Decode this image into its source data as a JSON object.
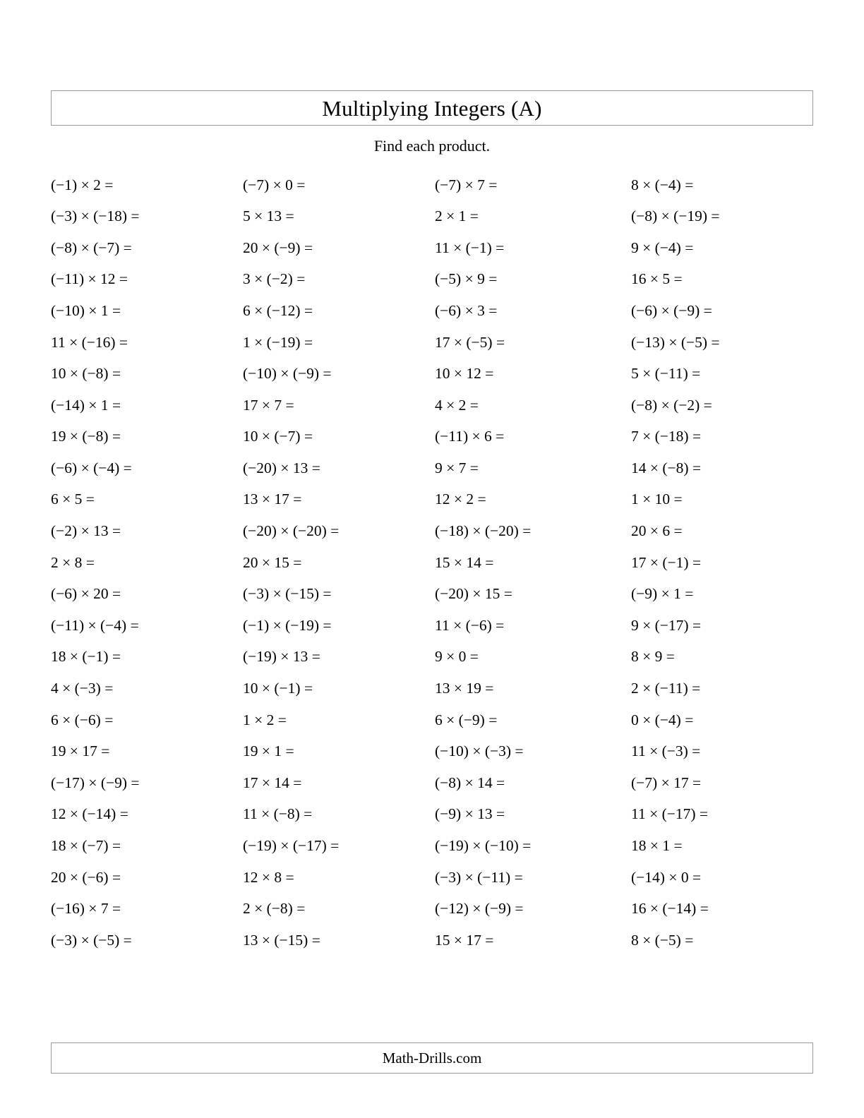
{
  "document": {
    "title": "Multiplying Integers (A)",
    "instruction": "Find each product.",
    "footer": "Math-Drills.com"
  },
  "problems": {
    "rows": [
      [
        "(−1) × 2 =",
        "(−7) × 0 =",
        "(−7) × 7 =",
        "8 × (−4) ="
      ],
      [
        "(−3) × (−18) =",
        "5 × 13 =",
        "2 × 1 =",
        "(−8) × (−19) ="
      ],
      [
        "(−8) × (−7) =",
        "20 × (−9) =",
        "11 × (−1) =",
        "9 × (−4) ="
      ],
      [
        "(−11) × 12 =",
        "3 × (−2) =",
        "(−5) × 9 =",
        "16 × 5 ="
      ],
      [
        "(−10) × 1 =",
        "6 × (−12) =",
        "(−6) × 3 =",
        "(−6) × (−9) ="
      ],
      [
        "11 × (−16) =",
        "1 × (−19) =",
        "17 × (−5) =",
        "(−13) × (−5) ="
      ],
      [
        "10 × (−8) =",
        "(−10) × (−9) =",
        "10 × 12 =",
        "5 × (−11) ="
      ],
      [
        "(−14) × 1 =",
        "17 × 7 =",
        "4 × 2 =",
        "(−8) × (−2) ="
      ],
      [
        "19 × (−8) =",
        "10 × (−7) =",
        "(−11) × 6 =",
        "7 × (−18) ="
      ],
      [
        "(−6) × (−4) =",
        "(−20) × 13 =",
        "9 × 7 =",
        "14 × (−8) ="
      ],
      [
        "6 × 5 =",
        "13 × 17 =",
        "12 × 2 =",
        "1 × 10 ="
      ],
      [
        "(−2) × 13 =",
        "(−20) × (−20) =",
        "(−18) × (−20) =",
        "20 × 6 ="
      ],
      [
        "2 × 8 =",
        "20 × 15 =",
        "15 × 14 =",
        "17 × (−1) ="
      ],
      [
        "(−6) × 20 =",
        "(−3) × (−15) =",
        "(−20) × 15 =",
        "(−9) × 1 ="
      ],
      [
        "(−11) × (−4) =",
        "(−1) × (−19) =",
        "11 × (−6) =",
        "9 × (−17) ="
      ],
      [
        "18 × (−1) =",
        "(−19) × 13 =",
        "9 × 0 =",
        "8 × 9 ="
      ],
      [
        "4 × (−3) =",
        "10 × (−1) =",
        "13 × 19 =",
        "2 × (−11) ="
      ],
      [
        "6 × (−6) =",
        "1 × 2 =",
        "6 × (−9) =",
        "0 × (−4) ="
      ],
      [
        "19 × 17 =",
        "19 × 1 =",
        "(−10) × (−3) =",
        "11 × (−3) ="
      ],
      [
        "(−17) × (−9) =",
        "17 × 14 =",
        "(−8) × 14 =",
        "(−7) × 17 ="
      ],
      [
        "12 × (−14) =",
        "11 × (−8) =",
        "(−9) × 13 =",
        "11 × (−17) ="
      ],
      [
        "18 × (−7) =",
        "(−19) × (−17) =",
        "(−19) × (−10) =",
        "18 × 1 ="
      ],
      [
        "20 × (−6) =",
        "12 × 8 =",
        "(−3) × (−11) =",
        "(−14) × 0 ="
      ],
      [
        "(−16) × 7 =",
        "2 × (−8) =",
        "(−12) × (−9) =",
        "16 × (−14) ="
      ],
      [
        "(−3) × (−5) =",
        "13 × (−15) =",
        "15 × 17 =",
        "8 × (−5) ="
      ]
    ]
  }
}
